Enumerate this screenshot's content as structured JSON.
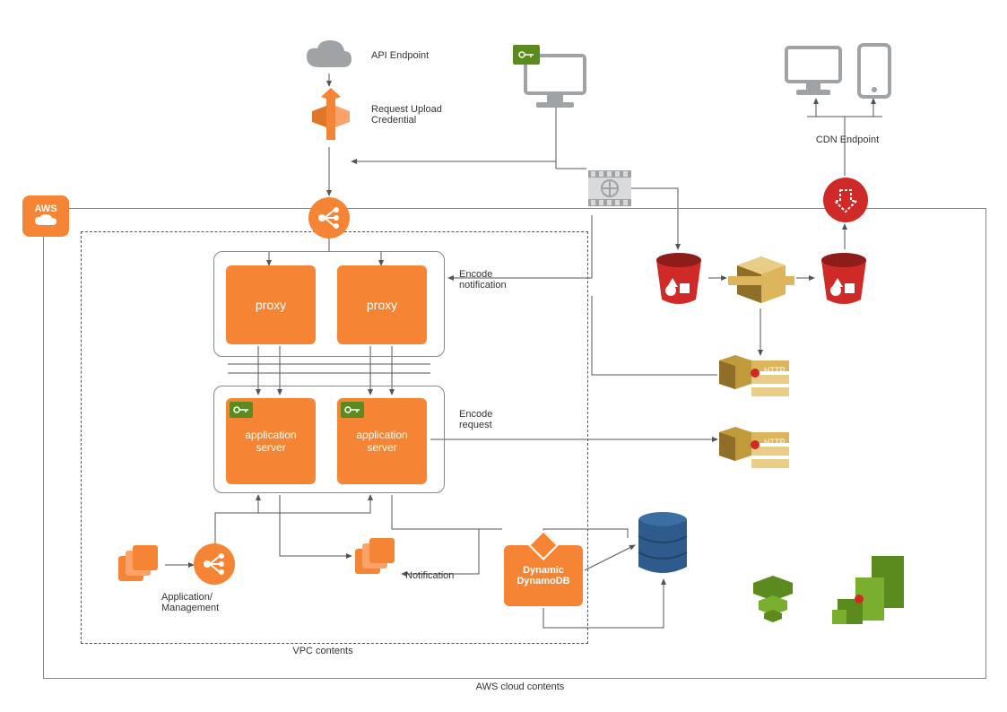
{
  "labels": {
    "api_endpoint": "API Endpoint",
    "request_upload_credential": "Request Upload\nCredential",
    "cdn_endpoint": "CDN Endpoint",
    "encode_notification": "Encode\nnotification",
    "encode_request": "Encode\nrequest",
    "notification": "Notification",
    "application_management": "Application/\nManagement",
    "vpc_contents": "VPC contents",
    "aws_cloud_contents": "AWS cloud contents",
    "aws_badge": "AWS"
  },
  "boxes": {
    "proxy1": "proxy",
    "proxy2": "proxy",
    "app1": "application\nserver",
    "app2": "application\nserver",
    "dynamo": "Dynamic\nDynamoDB",
    "http1": "HTTP",
    "http2": "HTTP"
  },
  "icons": {
    "cloud": "cloud-icon",
    "sts": "sts-token-service-icon",
    "elb_main": "load-balancer-icon",
    "elb_mgmt": "load-balancer-icon",
    "client_upload": "client-desktop-icon",
    "client_cdn_pc": "client-desktop-icon",
    "client_cdn_mobile": "client-mobile-icon",
    "key_upload": "key-credential-icon",
    "key_app1": "key-credential-icon",
    "key_app2": "key-credential-icon",
    "film": "video-media-icon",
    "bucket_in": "s3-bucket-icon",
    "transcoder": "elastic-transcoder-icon",
    "bucket_out": "s3-bucket-icon",
    "cloudfront": "cloudfront-icon",
    "sns1": "sns-topic-icon",
    "sns2": "sns-topic-icon",
    "files_mgmt": "instances-icon",
    "files_notif": "instances-icon",
    "dynamo_badge": "dynamodb-accelerator-icon",
    "db": "database-icon",
    "beanstalk": "elastic-beanstalk-icon",
    "cloudwatch": "cloudwatch-icon",
    "aws_cloud_badge": "aws-cloud-icon"
  },
  "colors": {
    "orange": "#F58534",
    "red": "#CF2A27",
    "gold": "#C19A3C",
    "blue": "#2E5B8B",
    "green": "#5B8B1E",
    "grey": "#9FA3A6"
  }
}
